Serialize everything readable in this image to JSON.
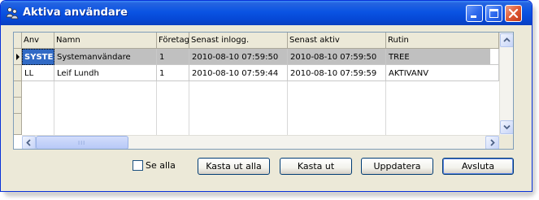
{
  "window": {
    "title": "Aktiva användare"
  },
  "grid": {
    "columns": [
      "Anv",
      "Namn",
      "Företag",
      "Senast inlogg.",
      "Senast aktiv",
      "Rutin"
    ],
    "rows": [
      {
        "anv": "SYSTE",
        "namn": "Systemanvändare",
        "foretag": "1",
        "senast_inlogg": "2010-08-10 07:59:50",
        "senast_aktiv": "2010-08-10 07:59:50",
        "rutin": "TREE"
      },
      {
        "anv": "LL",
        "namn": "Leif Lundh",
        "foretag": "1",
        "senast_inlogg": "2010-08-10 07:59:44",
        "senast_aktiv": "2010-08-10 07:59:59",
        "rutin": "AKTIVANV"
      }
    ],
    "scroll_grip": "III"
  },
  "footer": {
    "checkbox_label": "Se alla",
    "buttons": {
      "kick_all": "Kasta ut alla",
      "kick": "Kasta ut",
      "refresh": "Uppdatera",
      "exit": "Avsluta"
    }
  },
  "colors": {
    "titlebar": "#0a54e3",
    "selection": "#316ac5",
    "selected_row": "#c0c0c0",
    "close_button": "#df5a35"
  }
}
